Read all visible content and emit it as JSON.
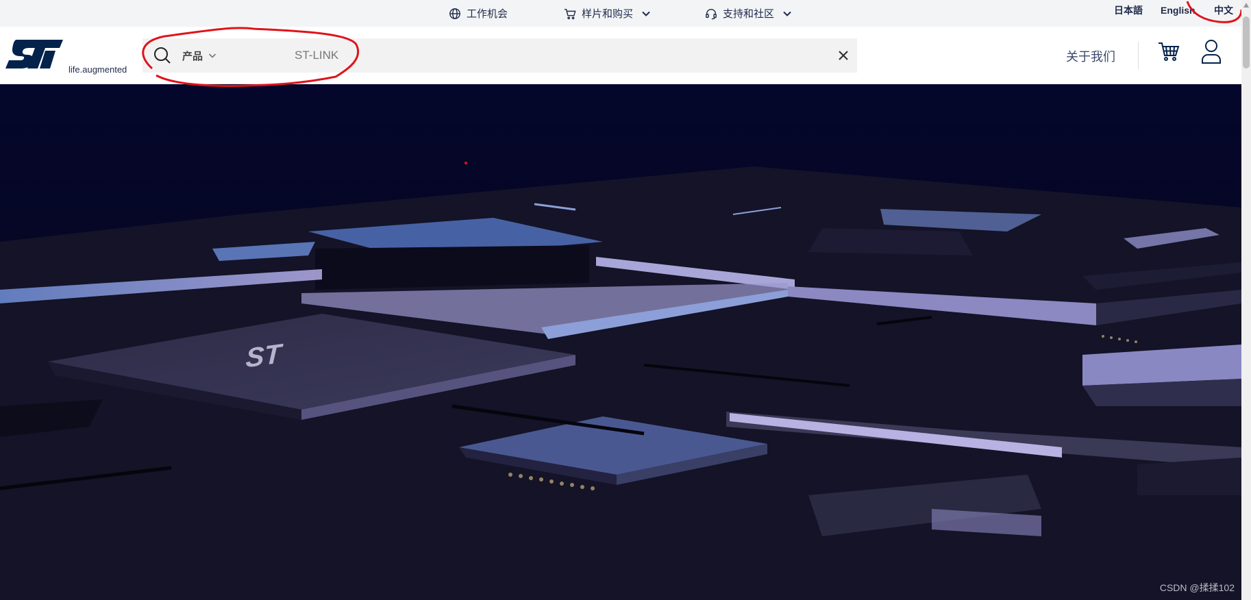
{
  "topbar": {
    "links": [
      {
        "label": "工作机会",
        "icon": "globe-icon"
      },
      {
        "label": "样片和购买",
        "icon": "cart-icon"
      },
      {
        "label": "支持和社区",
        "icon": "headset-icon"
      }
    ],
    "languages": [
      "日本語",
      "English",
      "中文"
    ]
  },
  "header": {
    "logo_text": "ST",
    "logo_tagline": "life.augmented",
    "search": {
      "category": "产品",
      "query": "ST-LINK"
    },
    "about_label": "关于我们",
    "icons": {
      "cart": "shopping-cart-icon",
      "user": "user-account-icon",
      "clear": "close-icon"
    }
  },
  "hero": {
    "chip_logo_text": "ST"
  },
  "watermark": "CSDN @揉揉102",
  "colors": {
    "brand": "#03234b",
    "hero_bg": "#0b0b25",
    "annotation": "#e0131a"
  }
}
